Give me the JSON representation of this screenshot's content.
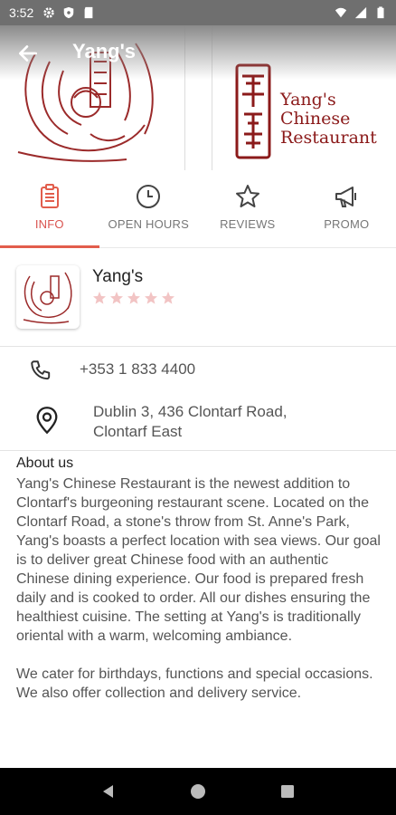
{
  "status_bar": {
    "time": "3:52",
    "left_icons": [
      "gear-icon",
      "shield-icon",
      "sd-card-icon"
    ],
    "right_icons": [
      "wifi-icon",
      "signal-icon",
      "battery-icon"
    ]
  },
  "header": {
    "title": "Yang's",
    "logo_lines": [
      "Yang's",
      "Chinese",
      "Restaurant"
    ],
    "accent": "#8b1a1a"
  },
  "tabs": [
    {
      "label": "INFO",
      "icon": "clipboard-icon",
      "active": true
    },
    {
      "label": "OPEN HOURS",
      "icon": "clock-icon",
      "active": false
    },
    {
      "label": "REVIEWS",
      "icon": "star-icon",
      "active": false
    },
    {
      "label": "PROMO",
      "icon": "megaphone-icon",
      "active": false
    }
  ],
  "restaurant": {
    "name": "Yang's",
    "rating_stars": 5
  },
  "contact": {
    "phone": "+353 1 833 4400",
    "address_line1": "Dublin 3, 436 Clontarf Road,",
    "address_line2": "Clontarf East"
  },
  "about": {
    "title": "About us",
    "paragraph1": "Yang's Chinese Restaurant is the newest addition to Clontarf's burgeoning restaurant scene. Located on the Clontarf Road, a stone's throw from St. Anne's Park, Yang's boasts a perfect location with sea views. Our goal is to deliver great Chinese food with an authentic Chinese dining experience. Our food is prepared fresh daily and is cooked to order. All our dishes ensuring the healthiest cuisine. The setting at Yang's is traditionally oriental with a warm, welcoming ambiance.",
    "paragraph2": "We cater for birthdays, functions and special occasions. We also offer collection and delivery service."
  },
  "colors": {
    "active_tab": "#e25d4c",
    "star_empty": "#f2c4c4",
    "brand": "#8b1a1a"
  }
}
